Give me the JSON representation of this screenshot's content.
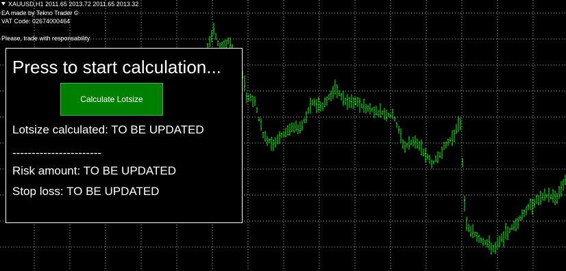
{
  "chart": {
    "header_symbol": "XAUUSD,H1  2011.65 2013.72 2011.65 2013.32",
    "header_made_by": "EA made by Tekno Trader ©",
    "header_vat": "VAT Code: 02674000464",
    "header_warning": "Please, trade with responsability",
    "background_color": "#000000",
    "grid_color": "#c0c0c0",
    "candle_color": "#00ff00"
  },
  "panel": {
    "title": "Press to start calculation...",
    "button_label": "Calculate Lotsize",
    "button_color": "#008000",
    "lotsize_text": "Lotsize calculated: TO BE UPDATED",
    "separator_text": "-----------------------",
    "risk_text": "Risk amount:  TO BE UPDATED",
    "stoploss_text": "Stop loss:  TO BE UPDATED"
  },
  "icons": {
    "symbol_menu": "dropdown-triangle-icon"
  }
}
